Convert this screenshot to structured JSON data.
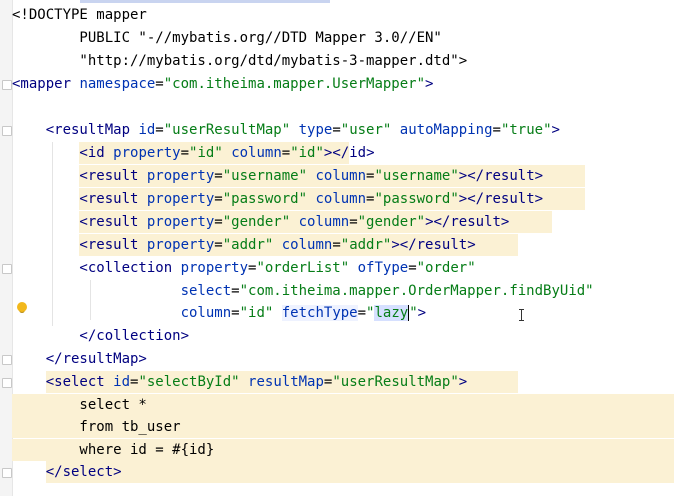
{
  "editor": {
    "language": "xml",
    "lines": [
      [
        [
          "p",
          "<!DOCTYPE mapper"
        ]
      ],
      [
        [
          "p",
          "        PUBLIC \"-//mybatis.org//DTD Mapper 3.0//EN\""
        ]
      ],
      [
        [
          "p",
          "        \"http://mybatis.org/dtd/mybatis-3-mapper.dtd\">"
        ]
      ],
      [
        [
          "t",
          "<mapper "
        ],
        [
          "a",
          "namespace"
        ],
        [
          "p",
          "="
        ],
        [
          "v",
          "\"com.itheima.mapper.UserMapper\""
        ],
        [
          "t",
          ">"
        ]
      ],
      [
        [
          "p",
          ""
        ]
      ],
      [
        [
          "t",
          "    <resultMap "
        ],
        [
          "a",
          "id"
        ],
        [
          "p",
          "="
        ],
        [
          "v",
          "\"userResultMap\""
        ],
        [
          "p",
          " "
        ],
        [
          "a",
          "type"
        ],
        [
          "p",
          "="
        ],
        [
          "v",
          "\"user\""
        ],
        [
          "p",
          " "
        ],
        [
          "a",
          "autoMapping"
        ],
        [
          "p",
          "="
        ],
        [
          "v",
          "\"true\""
        ],
        [
          "t",
          ">"
        ]
      ],
      [
        [
          "t",
          "        <id "
        ],
        [
          "a",
          "property"
        ],
        [
          "p",
          "="
        ],
        [
          "v",
          "\"id\""
        ],
        [
          "p",
          " "
        ],
        [
          "a",
          "column"
        ],
        [
          "p",
          "="
        ],
        [
          "v",
          "\"id\""
        ],
        [
          "t",
          "></id>"
        ]
      ],
      [
        [
          "t",
          "        <result "
        ],
        [
          "a",
          "property"
        ],
        [
          "p",
          "="
        ],
        [
          "v",
          "\"username\""
        ],
        [
          "p",
          " "
        ],
        [
          "a",
          "column"
        ],
        [
          "p",
          "="
        ],
        [
          "v",
          "\"username\""
        ],
        [
          "t",
          "></result>"
        ]
      ],
      [
        [
          "t",
          "        <result "
        ],
        [
          "a",
          "property"
        ],
        [
          "p",
          "="
        ],
        [
          "v",
          "\"password\""
        ],
        [
          "p",
          " "
        ],
        [
          "a",
          "column"
        ],
        [
          "p",
          "="
        ],
        [
          "v",
          "\"password\""
        ],
        [
          "t",
          "></result>"
        ]
      ],
      [
        [
          "t",
          "        <result "
        ],
        [
          "a",
          "property"
        ],
        [
          "p",
          "="
        ],
        [
          "v",
          "\"gender\""
        ],
        [
          "p",
          " "
        ],
        [
          "a",
          "column"
        ],
        [
          "p",
          "="
        ],
        [
          "v",
          "\"gender\""
        ],
        [
          "t",
          "></result>"
        ]
      ],
      [
        [
          "t",
          "        <result "
        ],
        [
          "a",
          "property"
        ],
        [
          "p",
          "="
        ],
        [
          "v",
          "\"addr\""
        ],
        [
          "p",
          " "
        ],
        [
          "a",
          "column"
        ],
        [
          "p",
          "="
        ],
        [
          "v",
          "\"addr\""
        ],
        [
          "t",
          "></result>"
        ]
      ],
      [
        [
          "t",
          "        <collection "
        ],
        [
          "a",
          "property"
        ],
        [
          "p",
          "="
        ],
        [
          "v",
          "\"orderList\""
        ],
        [
          "p",
          " "
        ],
        [
          "a",
          "ofType"
        ],
        [
          "p",
          "="
        ],
        [
          "v",
          "\"order\""
        ]
      ],
      [
        [
          "p",
          "                    "
        ],
        [
          "a",
          "select"
        ],
        [
          "p",
          "="
        ],
        [
          "v",
          "\"com.itheima.mapper.OrderMapper.findByUid\""
        ]
      ],
      [
        [
          "p",
          "                    "
        ],
        [
          "a",
          "column"
        ],
        [
          "p",
          "="
        ],
        [
          "v",
          "\"id\""
        ],
        [
          "p",
          " "
        ],
        [
          "ah",
          "fetchType"
        ],
        [
          "p",
          "="
        ],
        [
          "v",
          "\""
        ],
        [
          "vs",
          "lazy"
        ],
        [
          "v",
          "\""
        ],
        [
          "t",
          ">"
        ]
      ],
      [
        [
          "t",
          "        </collection>"
        ]
      ],
      [
        [
          "t",
          "    </resultMap>"
        ]
      ],
      [
        [
          "t",
          "    <select "
        ],
        [
          "a",
          "id"
        ],
        [
          "p",
          "="
        ],
        [
          "v",
          "\"selectById\""
        ],
        [
          "p",
          " "
        ],
        [
          "a",
          "resultMap"
        ],
        [
          "p",
          "="
        ],
        [
          "v",
          "\"userResultMap\""
        ],
        [
          "t",
          ">"
        ]
      ],
      [
        [
          "p",
          "        select *"
        ]
      ],
      [
        [
          "p",
          "        from tb_user"
        ]
      ],
      [
        [
          "p",
          "        where id = #{id}"
        ]
      ],
      [
        [
          "t",
          "    </select>"
        ]
      ]
    ],
    "colors": {
      "tag": "#000080",
      "attribute": "#0033b3",
      "value": "#067d17",
      "highlight": "#fbf1d4",
      "selection": "#d6e0ff"
    }
  }
}
